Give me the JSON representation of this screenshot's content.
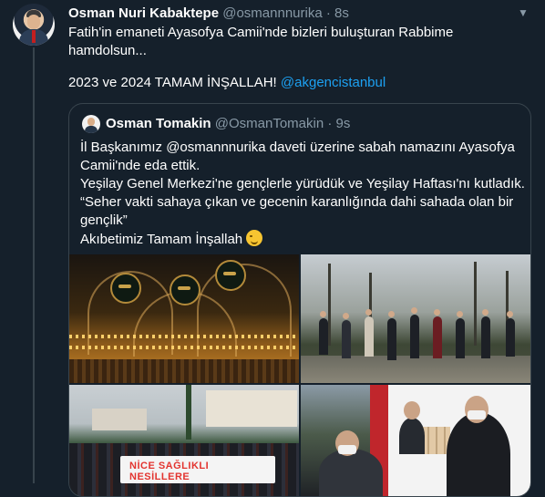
{
  "tweet": {
    "author_name": "Osman Nuri Kabaktepe",
    "author_handle": "@osmannnurika",
    "separator": "·",
    "time": "8s",
    "lines": [
      "Fatih'in emaneti Ayasofya Camii'nde bizleri buluşturan Rabbime",
      "hamdolsun..."
    ],
    "line3_text": "2023 ve 2024 TAMAM İNŞALLAH! ",
    "line3_mention": "@akgencistanbul"
  },
  "quote": {
    "author_name": "Osman Tomakin",
    "author_handle": "@OsmanTomakin",
    "separator": "·",
    "time": "9s",
    "lines": [
      "İl Başkanımız @osmannnurika daveti üzerine sabah namazını Ayasofya",
      "Camii'nde eda ettik.",
      "Yeşilay Genel Merkezi'ne gençlerle yürüdük ve Yeşilay Haftası'nı kutladık.",
      "“Seher vakti sahaya çıkan ve gecenin karanlığında dahi sahada olan bir",
      "gençlik”",
      "Akıbetimiz Tamam İnşallah"
    ],
    "emoji": "smirking-face",
    "banner_lines": [
      "NİCE SAĞLIKLI",
      "NESİLLERE"
    ]
  },
  "colors": {
    "background": "#15202b",
    "text": "#ffffff",
    "secondary": "#8899a6",
    "link": "#1da1f2",
    "border": "#38444d"
  }
}
